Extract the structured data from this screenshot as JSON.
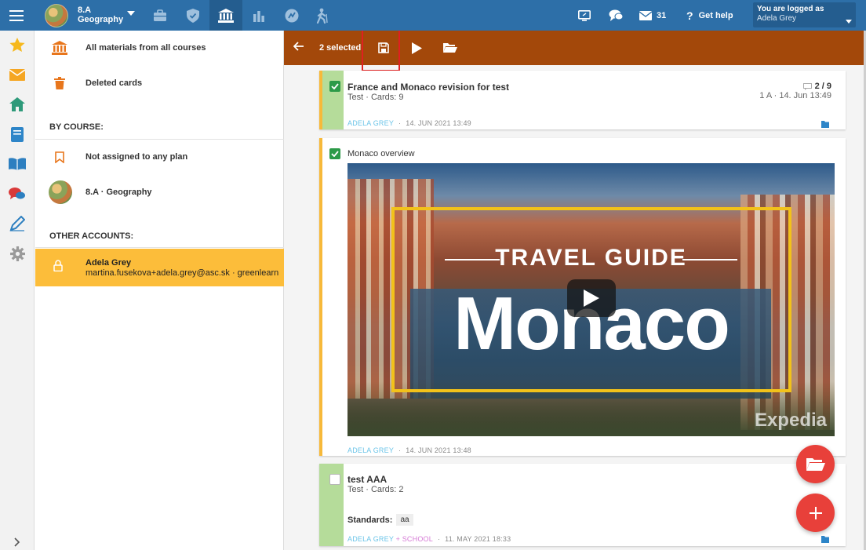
{
  "topbar": {
    "course_line1": "8.A",
    "course_line2": "Geography",
    "messages_count": "31",
    "help_label": "Get help",
    "logged_label": "You are logged as",
    "user_name": "Adela Grey"
  },
  "sidebar": {
    "all_materials": "All materials from all courses",
    "deleted_cards": "Deleted cards",
    "by_course_heading": "BY COURSE:",
    "not_assigned": "Not assigned to any plan",
    "course_item": "8.A · Geography",
    "other_accounts_heading": "OTHER ACCOUNTS:",
    "account_name": "Adela Grey",
    "account_email": "martina.fusekova+adela.grey@asc.sk · greenlearn"
  },
  "toolbar": {
    "selected_label": "2 selected:"
  },
  "cards": [
    {
      "title": "France and Monaco revision for test",
      "subtitle": "Test · Cards: 9",
      "progress": "2 / 9",
      "meta": "1 A · 14. Jun 13:49",
      "author": "ADELA GREY",
      "date": "14. JUN 2021 13:49",
      "checked": true
    },
    {
      "title": "Monaco overview",
      "video_heading": "TRAVEL GUIDE",
      "video_name": "Monaco",
      "video_brand": "Expedia",
      "author": "ADELA GREY",
      "date": "14. JUN 2021 13:48",
      "checked": true
    },
    {
      "title": "test AAA",
      "subtitle": "Test · Cards: 2",
      "standards_label": "Standards:",
      "standards_value": "aa",
      "author": "ADELA GREY",
      "school": "+ SCHOOL",
      "date": "11. MAY 2021 18:33",
      "checked": false
    }
  ],
  "colors": {
    "topbar": "#2d6fa8",
    "toolbar": "#a3480a",
    "accent_yellow": "#fcbd3a",
    "stripe_yellow": "#f7b93a",
    "stripe_green": "#b5dc9a",
    "fab": "#e8403a"
  },
  "icons": [
    "menu-icon",
    "briefcase-icon",
    "shield-icon",
    "bank-icon",
    "bar-chart-icon",
    "ranking-icon",
    "hiking-icon",
    "screen-cast-icon",
    "chat-icon",
    "envelope-icon",
    "help-icon",
    "star-icon",
    "home-icon",
    "book-icon",
    "open-book-icon",
    "discussion-icon",
    "pen-icon",
    "gear-icon",
    "save-icon",
    "play-icon",
    "folder-open-icon",
    "trash-icon",
    "bookmark-icon",
    "lock-icon",
    "plus-icon"
  ]
}
